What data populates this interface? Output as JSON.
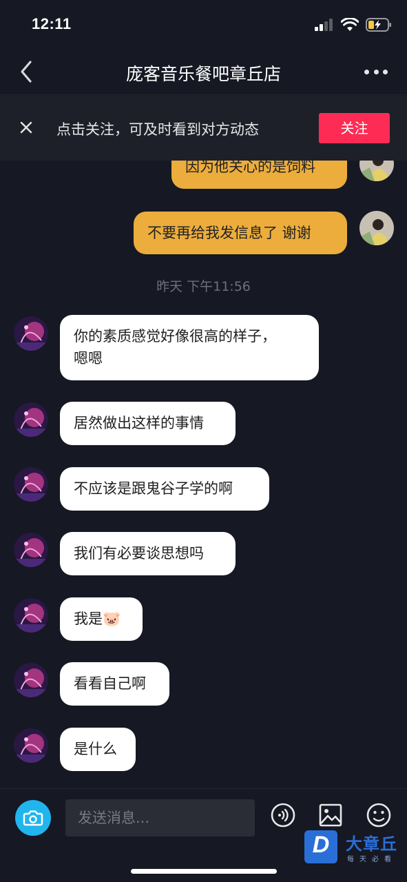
{
  "status_bar": {
    "time": "12:11"
  },
  "header": {
    "title": "庞客音乐餐吧章丘店"
  },
  "follow_banner": {
    "text": "点击关注，可及时看到对方动态",
    "button": "关注"
  },
  "messages": {
    "out": [
      {
        "text": "因为他关心的是饲料"
      },
      {
        "text": "不要再给我发信息了 谢谢"
      }
    ],
    "timestamp": "昨天 下午11:56",
    "in": [
      {
        "line1": "你的素质感觉好像很高的样子，",
        "line2": "嗯嗯"
      },
      {
        "text": "居然做出这样的事情"
      },
      {
        "text": "不应该是跟鬼谷子学的啊"
      },
      {
        "text": "我们有必要谈思想吗"
      },
      {
        "text": "我是🐷"
      },
      {
        "text": "看看自己啊"
      },
      {
        "text": "是什么"
      }
    ]
  },
  "composer": {
    "placeholder": "发送消息..."
  },
  "watermark": {
    "logo_letter": "D",
    "name": "大章丘",
    "slogan": "每天必看"
  },
  "colors": {
    "background": "#161823",
    "outgoing_bubble": "#ecad3c",
    "incoming_bubble": "#ffffff",
    "follow_button": "#fe2c55",
    "camera_button": "#21b5ee"
  }
}
